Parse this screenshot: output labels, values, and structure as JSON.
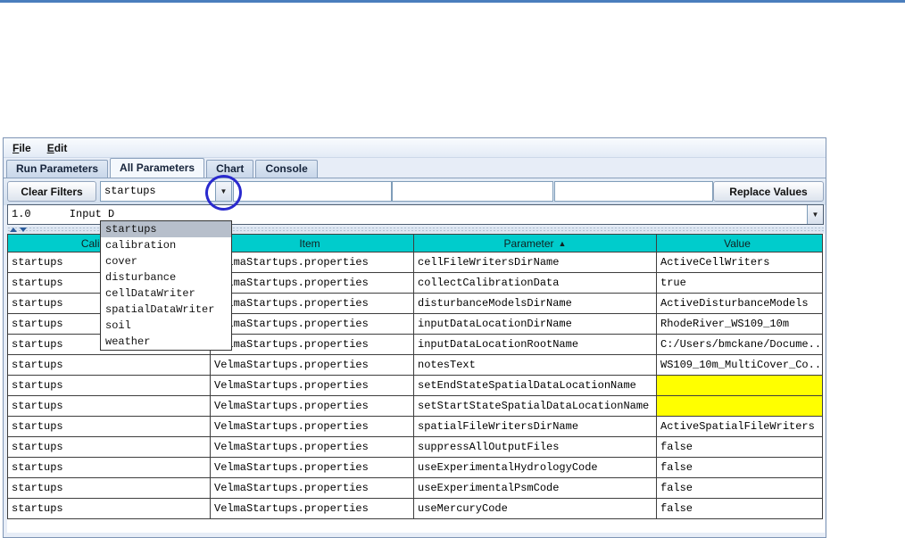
{
  "colors": {
    "top_line_blue": "#4a7ebd",
    "header_bg": "#00cccc",
    "highlight_yellow": "#ffff00",
    "annotation_blue": "#2a2ace"
  },
  "icons": {
    "combo_arrow": "▼"
  },
  "menubar": {
    "items": [
      {
        "label": "File"
      },
      {
        "label": "Edit"
      }
    ]
  },
  "tabbar": {
    "tabs": [
      {
        "label": "Run Parameters",
        "active": false
      },
      {
        "label": "All Parameters",
        "active": true
      },
      {
        "label": "Chart",
        "active": false
      },
      {
        "label": "Console",
        "active": false
      }
    ]
  },
  "toolbar": {
    "clear_filters_label": "Clear Filters",
    "group_filter_value": "startups",
    "filters": [
      "",
      "",
      ""
    ],
    "replace_values_label": "Replace Values"
  },
  "selector": {
    "value": "1.0      Input D"
  },
  "group_dropdown": {
    "selected": "startups",
    "items": [
      "startups",
      "calibration",
      "cover",
      "disturbance",
      "cellDataWriter",
      "spatialDataWriter",
      "soil",
      "weather"
    ]
  },
  "table": {
    "headers": [
      {
        "label": "Calibration",
        "sort": ""
      },
      {
        "label": "Item",
        "sort": ""
      },
      {
        "label": "Parameter",
        "sort": "▲"
      },
      {
        "label": "Value",
        "sort": ""
      }
    ],
    "rows": [
      {
        "calibration": "startups",
        "item": "VelmaStartups.properties",
        "parameter": "cellFileWritersDirName",
        "value": "ActiveCellWriters",
        "highlight": false
      },
      {
        "calibration": "startups",
        "item": "VelmaStartups.properties",
        "parameter": "collectCalibrationData",
        "value": "true",
        "highlight": false
      },
      {
        "calibration": "startups",
        "item": "VelmaStartups.properties",
        "parameter": "disturbanceModelsDirName",
        "value": "ActiveDisturbanceModels",
        "highlight": false
      },
      {
        "calibration": "startups",
        "item": "VelmaStartups.properties",
        "parameter": "inputDataLocationDirName",
        "value": "RhodeRiver_WS109_10m",
        "highlight": false
      },
      {
        "calibration": "startups",
        "item": "VelmaStartups.properties",
        "parameter": "inputDataLocationRootName",
        "value": "C:/Users/bmckane/Docume...",
        "highlight": false
      },
      {
        "calibration": "startups",
        "item": "VelmaStartups.properties",
        "parameter": "notesText",
        "value": "WS109_10m_MultiCover_Co...",
        "highlight": false
      },
      {
        "calibration": "startups",
        "item": "VelmaStartups.properties",
        "parameter": "setEndStateSpatialDataLocationName",
        "value": "",
        "highlight": true
      },
      {
        "calibration": "startups",
        "item": "VelmaStartups.properties",
        "parameter": "setStartStateSpatialDataLocationName",
        "value": "",
        "highlight": true
      },
      {
        "calibration": "startups",
        "item": "VelmaStartups.properties",
        "parameter": "spatialFileWritersDirName",
        "value": "ActiveSpatialFileWriters",
        "highlight": false
      },
      {
        "calibration": "startups",
        "item": "VelmaStartups.properties",
        "parameter": "suppressAllOutputFiles",
        "value": "false",
        "highlight": false
      },
      {
        "calibration": "startups",
        "item": "VelmaStartups.properties",
        "parameter": "useExperimentalHydrologyCode",
        "value": "false",
        "highlight": false
      },
      {
        "calibration": "startups",
        "item": "VelmaStartups.properties",
        "parameter": "useExperimentalPsmCode",
        "value": "false",
        "highlight": false
      },
      {
        "calibration": "startups",
        "item": "VelmaStartups.properties",
        "parameter": "useMercuryCode",
        "value": "false",
        "highlight": false
      }
    ]
  }
}
